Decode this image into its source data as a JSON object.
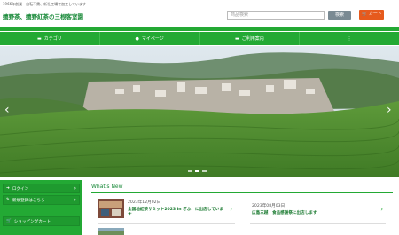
{
  "header": {
    "note": "1966年創業　自転不需、新社工場で加工しています",
    "brand": "嬉野茶、嬉野紅茶の三根客室園",
    "search_placeholder": "商品検索",
    "search_button": "検索",
    "cart_label": "カート"
  },
  "nav": {
    "items": [
      {
        "icon": "folder-icon",
        "label": "カテゴリ"
      },
      {
        "icon": "user-icon",
        "label": "マイページ"
      },
      {
        "icon": "folder-icon",
        "label": "ご利用案内"
      },
      {
        "icon": "more-icon",
        "label": "⋮"
      }
    ]
  },
  "hero": {
    "slides": 3,
    "active": 1
  },
  "sidebar": {
    "login": "ログイン",
    "register": "新規登録はこちら",
    "cart": "ショッピングカート"
  },
  "news": {
    "heading": "What's New",
    "items": [
      {
        "date": "2023年12月02日",
        "title": "全国地紅茶サミット2023 in ぎふ　に出店しています"
      },
      {
        "date": "2023年08月03日",
        "title": "広島三越　食品感謝祭に出店します"
      }
    ]
  },
  "colors": {
    "green": "#23a934",
    "cart": "#e65a1d"
  }
}
